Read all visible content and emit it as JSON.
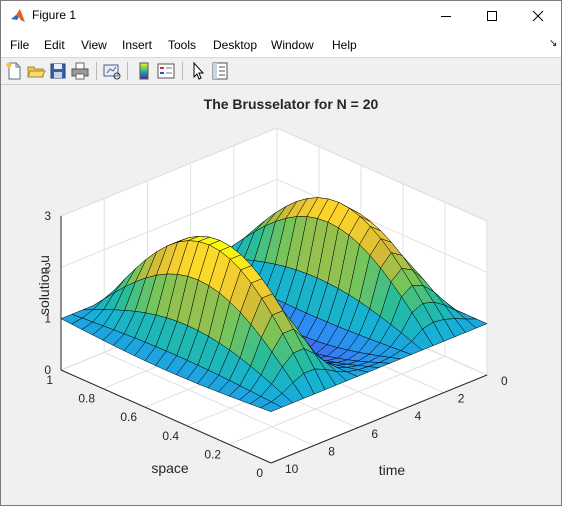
{
  "window": {
    "title": "Figure 1"
  },
  "menu": [
    "File",
    "Edit",
    "View",
    "Insert",
    "Tools",
    "Desktop",
    "Window",
    "Help"
  ],
  "toolbar": [
    "new-figure",
    "open-file",
    "save",
    "print",
    "link-plot",
    "insert-colorbar",
    "insert-legend",
    "edit-plot",
    "property-inspector"
  ],
  "colors": {
    "title_bar": "#ffffff",
    "figure_bg": "#f0f0f0",
    "mesh_line": "#000000",
    "colormap": "parula"
  },
  "chart_data": {
    "type": "surface",
    "title": "The Brusselator for N = 20",
    "xlabel": "time",
    "ylabel": "space",
    "zlabel": "solution u",
    "xlim": [
      0,
      10
    ],
    "ylim": [
      0,
      1
    ],
    "zlim": [
      0,
      3
    ],
    "xticks": [
      "0",
      "2",
      "4",
      "6",
      "8",
      "10"
    ],
    "yticks": [
      "0",
      "0.2",
      "0.4",
      "0.6",
      "0.8",
      "1"
    ],
    "zticks": [
      "0",
      "1",
      "2",
      "3"
    ],
    "grid": true,
    "colormap": "parula",
    "time": [
      0,
      0.5,
      1,
      1.5,
      2,
      2.5,
      3,
      3.5,
      4,
      4.5,
      5,
      5.5,
      6,
      6.5,
      7,
      7.5,
      8,
      8.5,
      9,
      9.5,
      10
    ],
    "space": [
      0.05,
      0.1,
      0.15,
      0.2,
      0.25,
      0.3,
      0.35,
      0.4,
      0.45,
      0.5,
      0.55,
      0.6,
      0.65,
      0.7,
      0.75,
      0.8,
      0.85,
      0.9,
      0.95
    ],
    "u_profile": [
      1.0,
      1.55,
      2.15,
      2.6,
      2.8,
      2.5,
      1.5,
      0.9,
      0.6,
      0.5,
      0.55,
      0.7,
      1.0,
      1.6,
      2.4,
      3.0,
      3.0,
      2.4,
      1.6,
      1.1,
      0.9
    ]
  }
}
